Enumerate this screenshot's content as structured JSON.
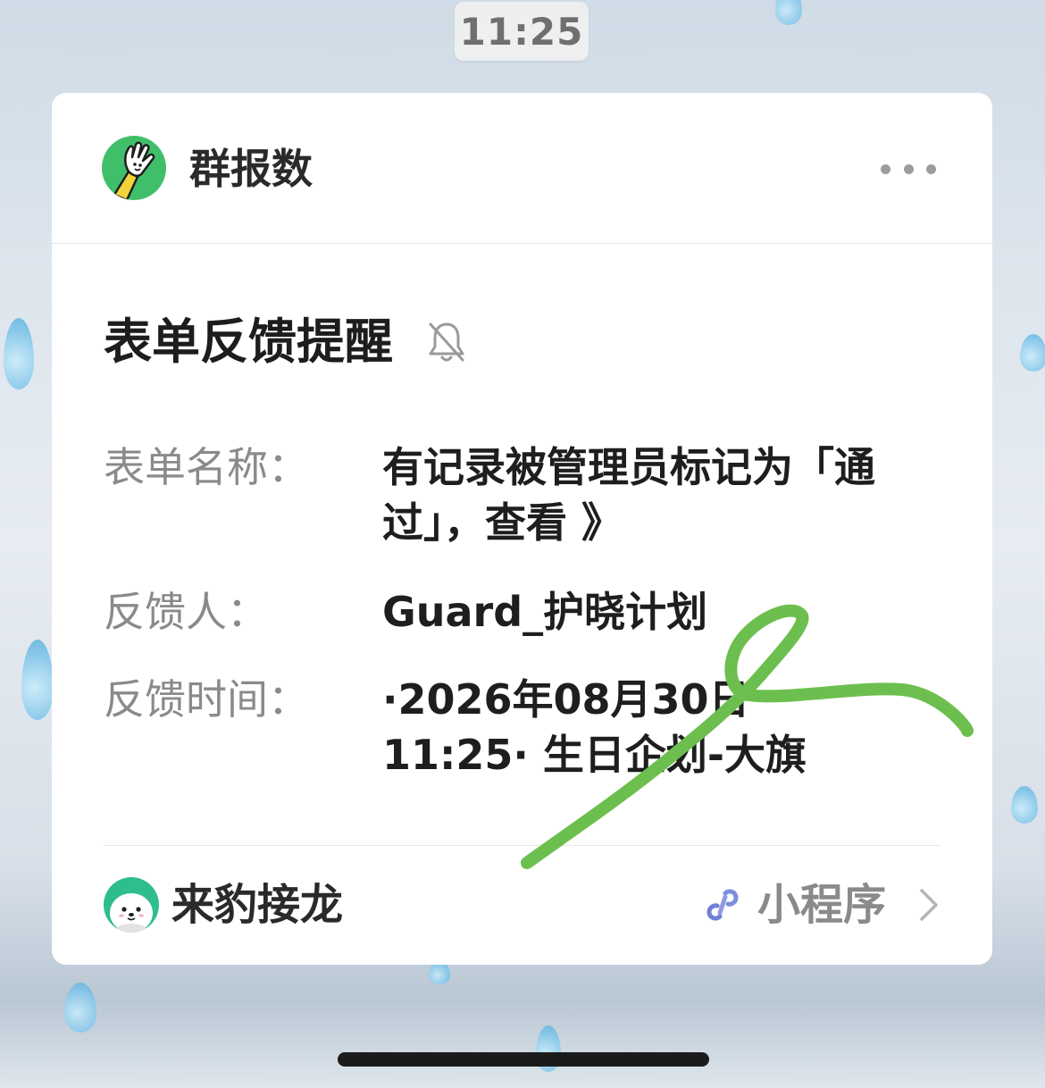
{
  "status_bar": {
    "time": "11:25"
  },
  "card": {
    "app_name": "群报数",
    "app_icon": "waving-hand-icon",
    "more_icon": "more-dots-icon",
    "title": "表单反馈提醒",
    "mute_icon": "bell-off-icon",
    "fields": [
      {
        "label": "表单名称：",
        "value_lines": [
          "有记录被管理员标记为「通",
          "过」，查看 》"
        ]
      },
      {
        "label": "反馈人：",
        "value_lines": [
          "Guard_护晓计划"
        ]
      },
      {
        "label": "反馈时间：",
        "value_lines": [
          "·2026年08月30日",
          "11:25· 生日企划-大旗"
        ]
      }
    ],
    "footer": {
      "source_name": "来豹接龙",
      "source_icon": "seal-mascot-icon",
      "mini_program_icon": "link-icon",
      "mini_program_label": "小程序",
      "chevron_icon": "chevron-right-icon"
    }
  },
  "colors": {
    "scribble": "#6cbf4e",
    "card_background": "#ffffff",
    "app_icon_background": "#3fbf6a",
    "source_icon_background": "#2fbd8f",
    "mini_program_icon": "#7b8fdc"
  }
}
